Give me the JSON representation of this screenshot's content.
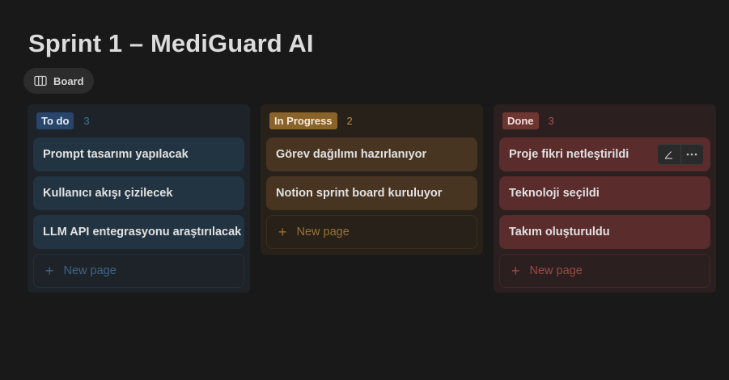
{
  "page": {
    "title": "Sprint 1 – MediGuard AI"
  },
  "view_tab": {
    "label": "Board",
    "icon": "board-columns-icon"
  },
  "columns": [
    {
      "status": "To do",
      "count": "3",
      "color": "#28456c",
      "cards": [
        "Prompt tasarımı yapılacak",
        "Kullanıcı akışı çizilecek",
        "LLM API entegrasyonu araştırılacak"
      ],
      "new_page_label": "New page"
    },
    {
      "status": "In Progress",
      "count": "2",
      "color": "#89632a",
      "cards": [
        "Görev dağılımı hazırlanıyor",
        "Notion sprint board kuruluyor"
      ],
      "new_page_label": "New page"
    },
    {
      "status": "Done",
      "count": "3",
      "color": "#6e3630",
      "cards": [
        "Proje fikri netleştirildi",
        "Teknoloji seçildi",
        "Takım oluşturuldu"
      ],
      "new_page_label": "New page"
    }
  ],
  "hover_actions": {
    "edit_icon": "pencil-icon",
    "more_icon": "more-horizontal-icon"
  }
}
